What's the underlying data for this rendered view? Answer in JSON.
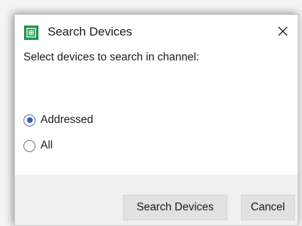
{
  "dialog": {
    "title": "Search Devices",
    "icon": "grid-app-icon",
    "close_icon": "close-icon"
  },
  "content": {
    "prompt": "Select devices to search in channel:",
    "options": [
      {
        "label": "Addressed",
        "selected": true
      },
      {
        "label": "All",
        "selected": false
      }
    ]
  },
  "footer": {
    "search_label": "Search Devices",
    "cancel_label": "Cancel"
  },
  "colors": {
    "app_icon": "#1e9e4a",
    "radio_accent": "#3b5ea8",
    "footer_bg": "#f0f0f0",
    "button_bg": "#e1e1e1"
  }
}
